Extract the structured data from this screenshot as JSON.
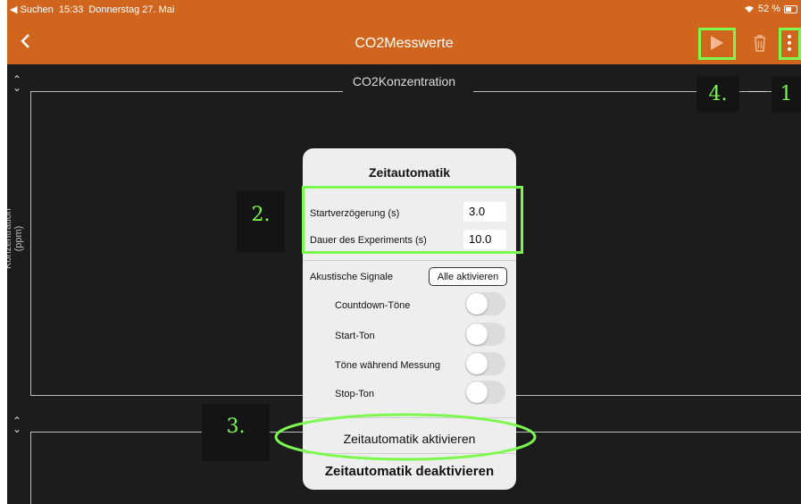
{
  "status_bar": {
    "back_app": "◀ Suchen",
    "time": "15:33",
    "date": "Donnerstag 27. Mai",
    "battery": "52 %"
  },
  "nav": {
    "back_icon": "chevron-left",
    "title": "CO2Messwerte",
    "play_icon": "play",
    "trash_icon": "trash",
    "more_icon": "more-vertical"
  },
  "chart": {
    "title": "CO2Konzentration",
    "ylabel": "Konzentration (ppm)"
  },
  "popup": {
    "title": "Zeitautomatik",
    "start_delay_label": "Startverzögerung (s)",
    "start_delay_value": "3.0",
    "duration_label": "Dauer des Experiments (s)",
    "duration_value": "10.0",
    "signals_label": "Akustische Signale",
    "enable_all_label": "Alle aktivieren",
    "signals": [
      {
        "label": "Countdown-Töne",
        "on": false
      },
      {
        "label": "Start-Ton",
        "on": false
      },
      {
        "label": "Töne während Messung",
        "on": false
      },
      {
        "label": "Stop-Ton",
        "on": false
      }
    ],
    "activate_label": "Zeitautomatik aktivieren",
    "deactivate_label": "Zeitautomatik deaktivieren"
  },
  "annotations": {
    "a1": "1",
    "a2": "2.",
    "a3": "3.",
    "a4": "4."
  },
  "colors": {
    "nav_orange": "#d0661e",
    "highlight_green": "#7cf94e",
    "background": "#1c1c1c"
  }
}
